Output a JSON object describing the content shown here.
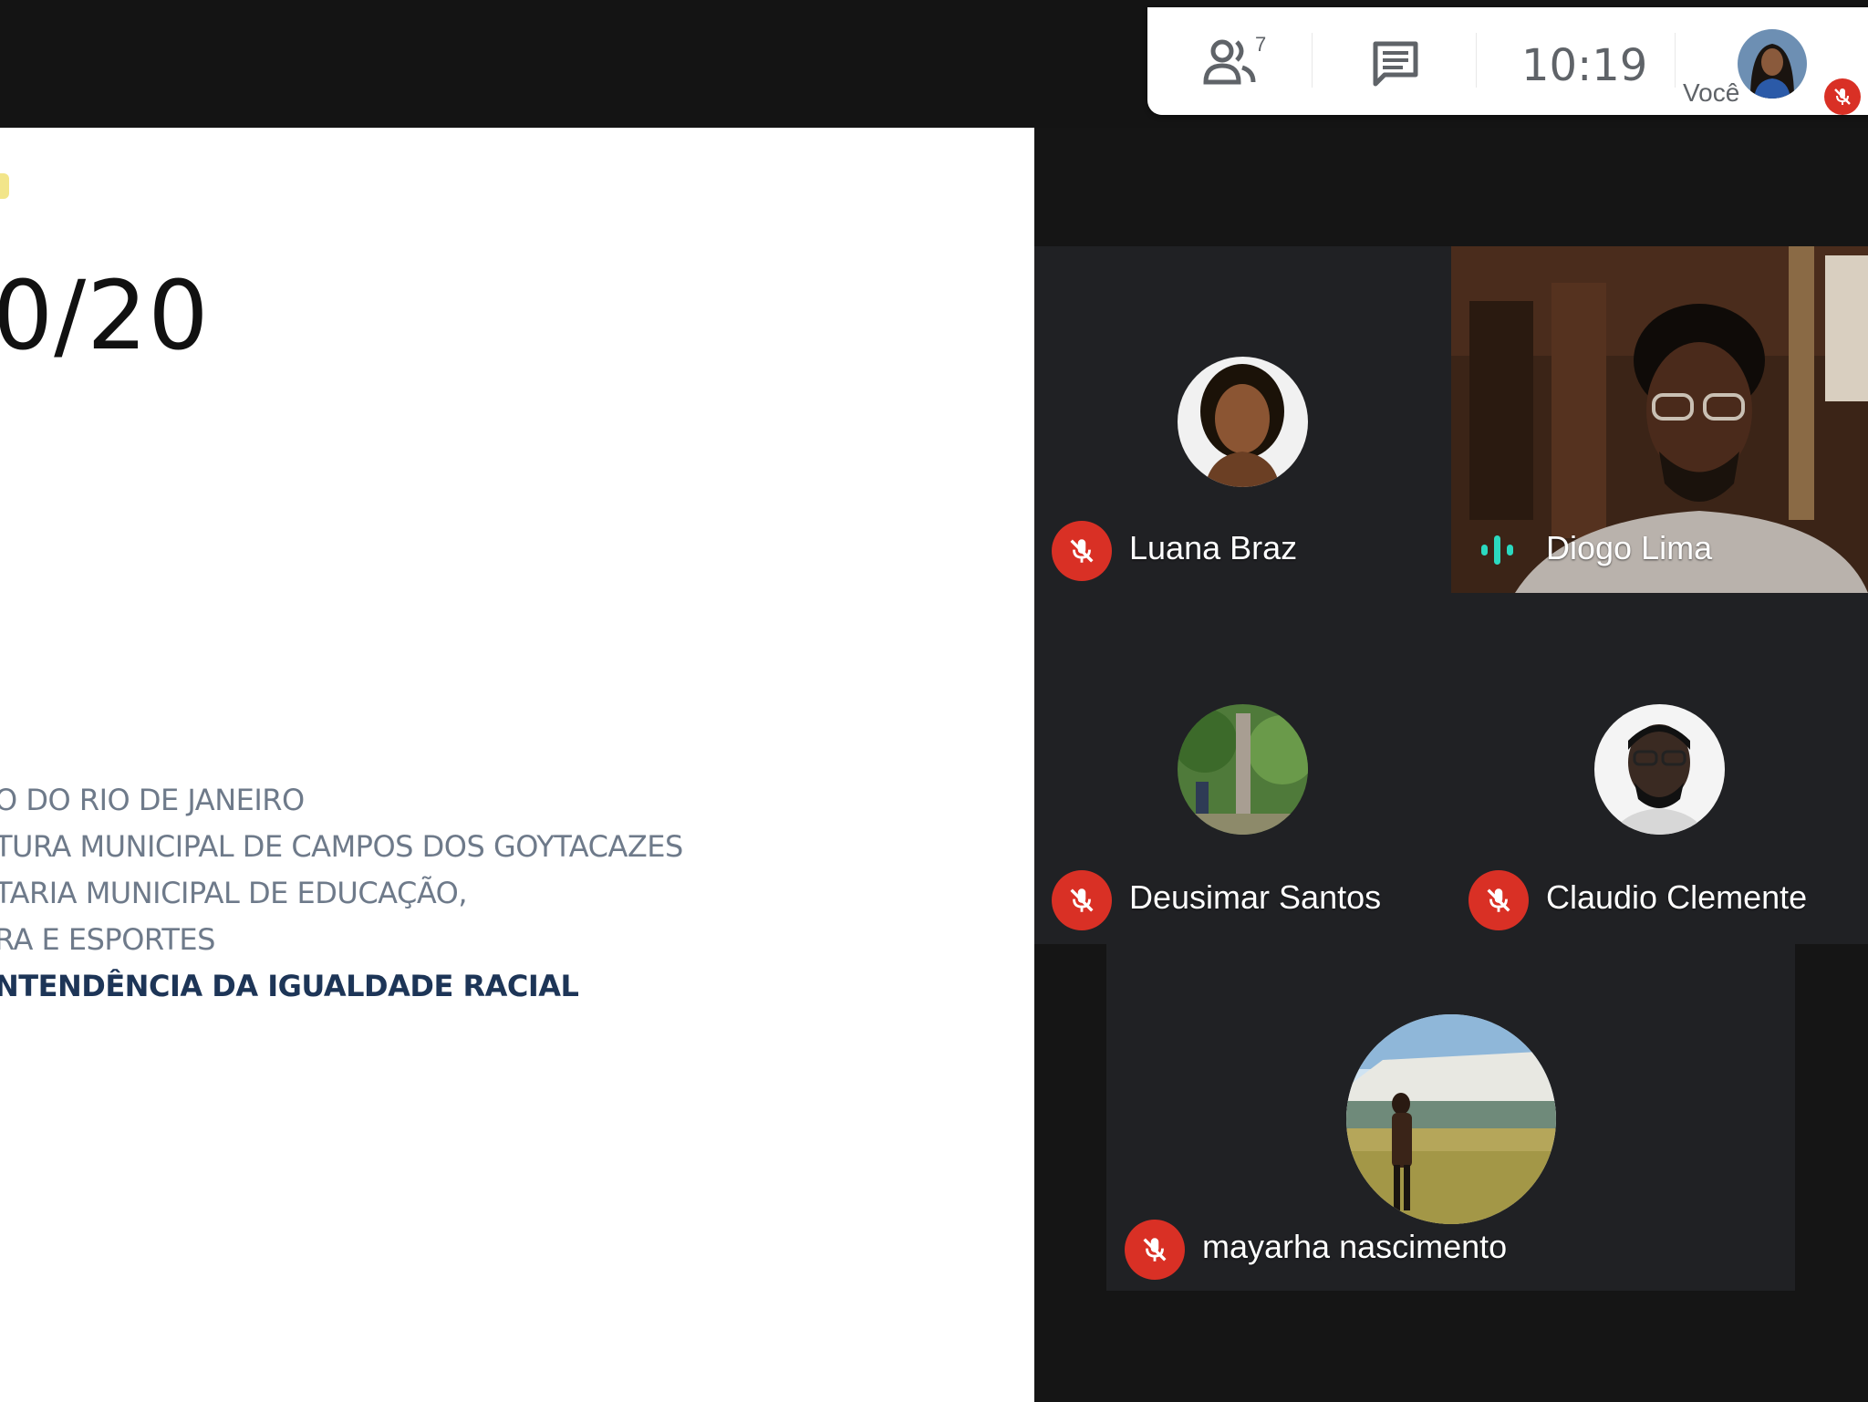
{
  "slide": {
    "date_fragment": "0/20",
    "lines": [
      "O DO RIO DE JANEIRO",
      "TURA MUNICIPAL DE CAMPOS DOS GOYTACAZES",
      "TARIA MUNICIPAL DE EDUCAÇÃO,",
      "RA E ESPORTES",
      "NTENDÊNCIA DA IGUALDADE RACIAL"
    ]
  },
  "controls": {
    "participant_count": "7",
    "time": "10:19",
    "you_label": "Você"
  },
  "participants": [
    {
      "name": "Luana Braz"
    },
    {
      "name": "Diogo Lima"
    },
    {
      "name": "Deusimar Santos"
    },
    {
      "name": "Claudio Clemente"
    },
    {
      "name": "mayarha nascimento"
    }
  ],
  "colors": {
    "mute_red": "#d93025",
    "speaking_teal": "#2bd9c0",
    "tile_bg": "#202124"
  }
}
